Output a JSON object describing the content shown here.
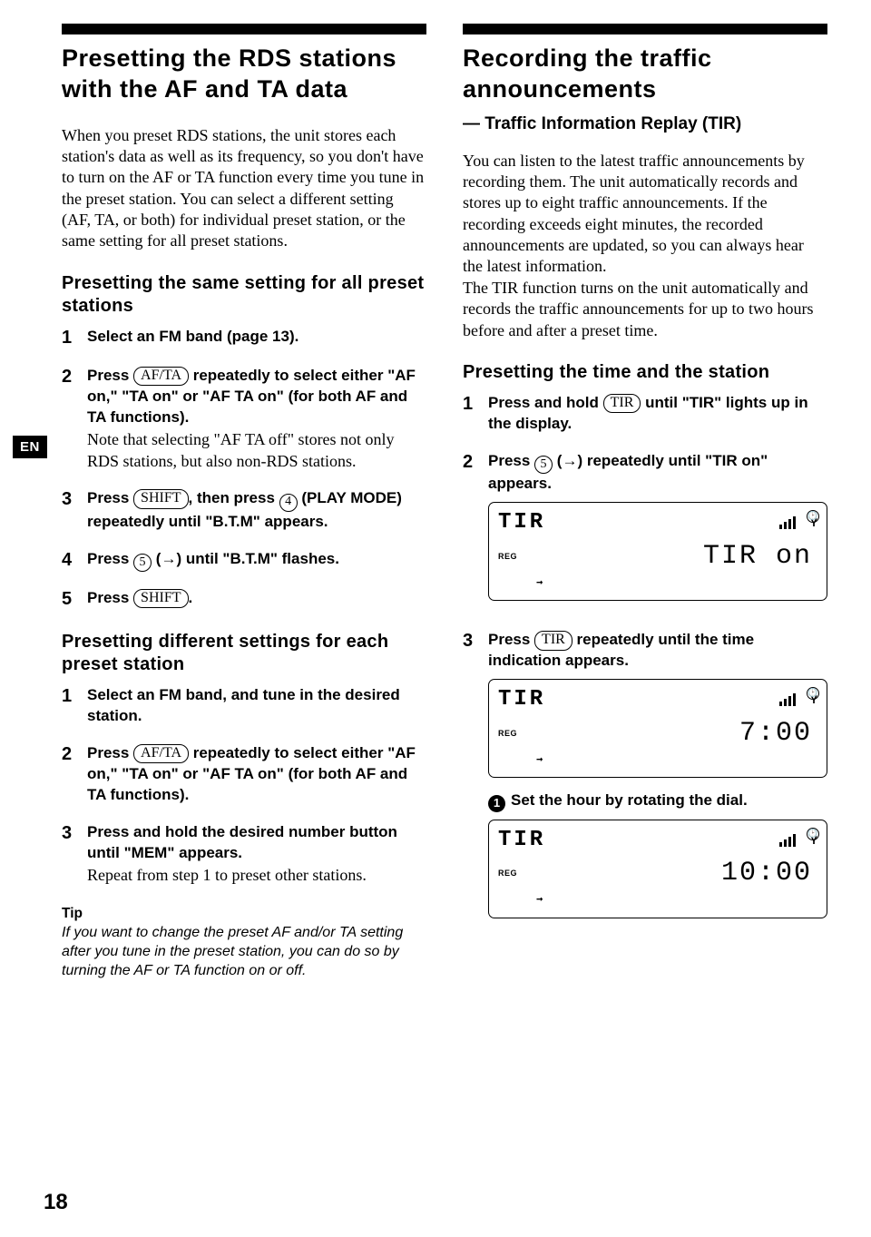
{
  "lang_tab": "EN",
  "page_number": "18",
  "left": {
    "h1": "Presetting the RDS stations with the AF and TA data",
    "intro": "When you preset RDS stations, the unit stores each station's data as well as its frequency, so you don't have to turn on the AF or TA function every time you tune in the preset station. You can select a different setting (AF, TA, or both) for individual preset station, or the same setting for all preset stations.",
    "sec1_h": "Presetting the same setting for all preset stations",
    "sec1_steps": [
      {
        "n": "1",
        "bold": "Select an FM band (page 13).",
        "note": ""
      },
      {
        "n": "2",
        "bold": "Press |AF/TA| repeatedly to select either \"AF on,\" \"TA on\" or \"AF TA on\" (for both AF and TA functions).",
        "note": "Note that selecting \"AF TA off\" stores not only RDS stations, but also non-RDS stations."
      },
      {
        "n": "3",
        "bold": "Press |SHIFT|, then press (4) (PLAY MODE) repeatedly until \"B.T.M\" appears.",
        "note": ""
      },
      {
        "n": "4",
        "bold": "Press (5) (→) until \"B.T.M\" flashes.",
        "note": ""
      },
      {
        "n": "5",
        "bold": "Press |SHIFT|.",
        "note": ""
      }
    ],
    "sec2_h": "Presetting different settings for each preset station",
    "sec2_steps": [
      {
        "n": "1",
        "bold": "Select an FM band, and tune in the desired station.",
        "note": ""
      },
      {
        "n": "2",
        "bold": "Press |AF/TA| repeatedly to select either \"AF on,\" \"TA on\" or \"AF TA on\" (for both AF and TA functions).",
        "note": ""
      },
      {
        "n": "3",
        "bold": "Press and hold the desired number button until \"MEM\" appears.",
        "note": "Repeat from step 1 to preset other stations."
      }
    ],
    "tip_h": "Tip",
    "tip": "If you want to change the preset AF and/or TA setting after you tune in the preset station, you can do so by turning the AF or TA function on or off."
  },
  "right": {
    "h1": "Recording the traffic announcements",
    "dash": "— Traffic Information Replay (TIR)",
    "intro1": "You can listen to the latest traffic announcements by recording them. The unit automatically records and stores up to eight traffic announcements. If the recording exceeds eight minutes, the recorded announcements are updated, so you can always hear the latest information.",
    "intro2": "The TIR function turns on the unit automatically and records the traffic announcements for up to two hours before and after a preset time.",
    "sec1_h": "Presetting the time and the station",
    "steps": [
      {
        "n": "1",
        "bold": "Press and hold |TIR| until \"TIR\" lights up in the display."
      },
      {
        "n": "2",
        "bold": "Press (5) (→) repeatedly until \"TIR on\" appears."
      },
      {
        "n": "3",
        "bold": "Press |TIR| repeatedly until the time indication appears."
      }
    ],
    "sub_instr": "Set the hour by rotating the dial.",
    "lcd_mode": "TIR",
    "lcd_reg": "REG",
    "lcd1_main": "TIR on",
    "lcd2_main": "7:00",
    "lcd3_main": "10:00"
  }
}
